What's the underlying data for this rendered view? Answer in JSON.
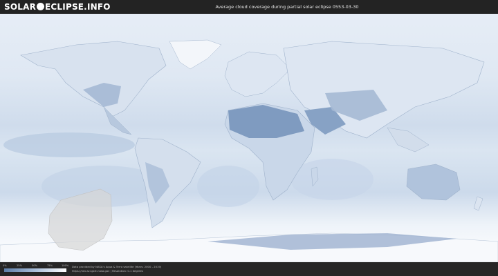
{
  "header": {
    "logo_left": "SOLAR",
    "logo_right": "ECLIPSE.INFO",
    "title": "Average cloud coverage during partial solar eclipse 0553-03-30"
  },
  "legend": {
    "ticks": [
      "0%",
      "25%",
      "50%",
      "75%",
      "100%"
    ],
    "colors": {
      "clear": "#5d7ea8",
      "mid": "#a9bfdb",
      "overcast": "#ffffff"
    }
  },
  "footer": {
    "source_line": "Data provided by NASA's Aqua & Terra satellite (Years: 2000 - 2019)",
    "info_line": "https://neo.sci.gsfc.nasa.gov | Resolution: 0.1 degrees"
  },
  "map": {
    "background": "#e9eff7",
    "eclipse_shadow_color": "#d7d7d7"
  }
}
